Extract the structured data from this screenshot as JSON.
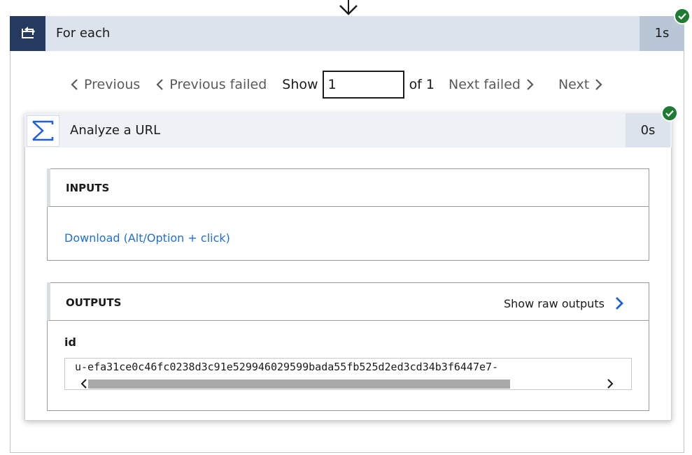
{
  "colors": {
    "header_dark": "#243a5e",
    "header_light": "#dce3ec",
    "success_green": "#1e7b32",
    "link_blue": "#1f6fd1"
  },
  "outer_card": {
    "title": "For each",
    "duration": "1s",
    "icon": "loop-icon",
    "status": "succeeded"
  },
  "pager": {
    "previous_label": "Previous",
    "previous_failed_label": "Previous failed",
    "show_label": "Show",
    "current_value": "1",
    "of_label": "of 1",
    "next_failed_label": "Next failed",
    "next_label": "Next"
  },
  "inner_card": {
    "title": "Analyze a URL",
    "duration": "0s",
    "icon": "sigma-icon",
    "status": "succeeded",
    "inputs": {
      "heading": "INPUTS",
      "download_link": "Download (Alt/Option + click)"
    },
    "outputs": {
      "heading": "OUTPUTS",
      "show_raw_label": "Show raw outputs",
      "id_label": "id",
      "id_value": "u-efa31ce0c46fc0238d3c91e529946029599bada55fb525d2ed3cd34b3f6447e7-"
    }
  }
}
